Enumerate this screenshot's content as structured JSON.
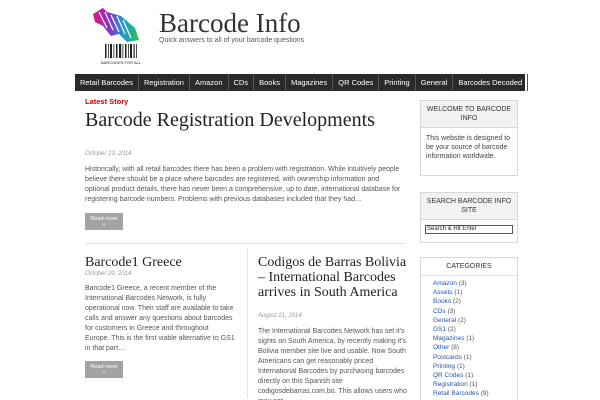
{
  "site": {
    "title": "Barcode Info",
    "tagline": "Quick answers to all of your barcode questions",
    "logo_text": "BARCODES FOR ALL"
  },
  "nav": [
    "Retail Barcodes",
    "Registration",
    "Amazon",
    "CDs",
    "Books",
    "Magazines",
    "QR Codes",
    "Printing",
    "General",
    "Barcodes Decoded"
  ],
  "main": {
    "latest_label": "Latest Story",
    "featured": {
      "title": "Barcode Registration Developments",
      "date": "October 23, 2014",
      "excerpt": "Historically, with all retail barcodes there has been a problem with registration. While intuitively people believe there should be a place where barcodes are registered, with ownership information and optional product details, there has never been a comprehensive, up to date, international database for registering barcode numbers. Problems with previous databases included that they had…",
      "read_more": "Read more"
    },
    "post_left": {
      "title": "Barcode1 Greece",
      "date": "October 20, 2014",
      "excerpt": "Barcode1 Greece, a recent member of the International Barcodes Network, is fully operational now. Their staff are available to take calls and answer any questions about barcodes for customers in Greece and throughout Europe. This is the first viable alternative to GS1 in that part…",
      "read_more": "Read more"
    },
    "post_right": {
      "title": "Codigos de Barras Bolivia – International Barcodes arrives in South America",
      "date": "August 21, 2014",
      "excerpt": "The International Barcodes Network has set it's sights on South America, by recently making it's Bolivia member site live and usable. Now South Americans can get reasonably priced International Barcodes by purchasing barcodes directly on this Spanish site codigosdebarras.com.bo. This allows users who may not…"
    }
  },
  "sidebar": {
    "welcome": {
      "title": "WELCOME TO BARCODE INFO",
      "body": "This website is designed to be your source of barcode information worldwide."
    },
    "search": {
      "title": "SEARCH BARCODE INFO SITE",
      "placeholder": "Search & Hit Enter"
    },
    "categories": {
      "title": "CATEGORIES",
      "items": [
        {
          "name": "Amazon",
          "count": "(3)"
        },
        {
          "name": "Assets",
          "count": "(1)"
        },
        {
          "name": "Books",
          "count": "(2)"
        },
        {
          "name": "CDs",
          "count": "(3)"
        },
        {
          "name": "General",
          "count": "(2)"
        },
        {
          "name": "GS1",
          "count": "(2)"
        },
        {
          "name": "Magazines",
          "count": "(1)"
        },
        {
          "name": "Other",
          "count": "(8)"
        },
        {
          "name": "Postcards",
          "count": "(1)"
        },
        {
          "name": "Printing",
          "count": "(1)"
        },
        {
          "name": "QR Codes",
          "count": "(1)"
        },
        {
          "name": "Registration",
          "count": "(1)"
        },
        {
          "name": "Retail Barcodes",
          "count": "(9)"
        }
      ]
    }
  }
}
